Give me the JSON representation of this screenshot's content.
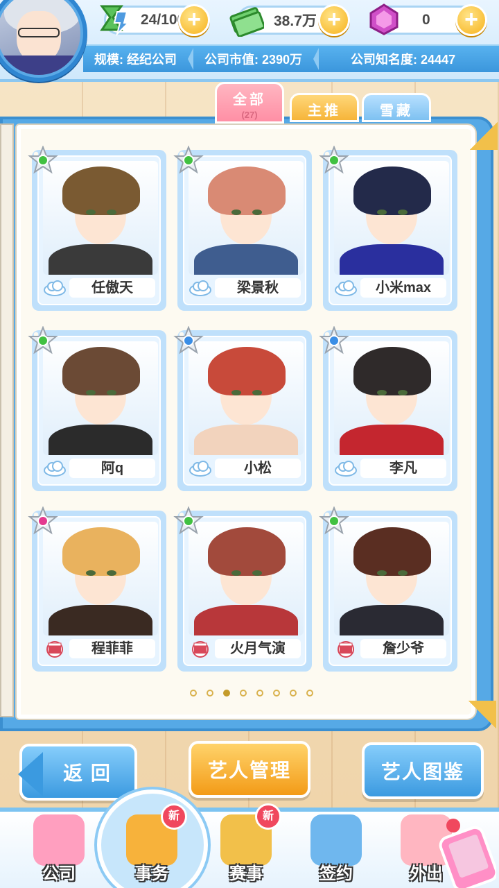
{
  "header": {
    "energy": "24/100",
    "money": "38.7万",
    "gems": "0",
    "stats": {
      "scale": "规模: 经纪公司",
      "market_value": "公司市值: 2390万",
      "fame": "公司知名度: 24447"
    }
  },
  "tabs": [
    {
      "label": "全部",
      "count": "(27)",
      "active": true
    },
    {
      "label": "主推"
    },
    {
      "label": "雪藏"
    }
  ],
  "artists": [
    {
      "name": "任傲天",
      "gem": "green",
      "type": "cloud-icon",
      "hair": "#7a5a32",
      "outfit": "#3a3a3a"
    },
    {
      "name": "梁景秋",
      "gem": "green",
      "type": "cloud-icon",
      "hair": "#d98a74",
      "outfit": "#3f5d8f"
    },
    {
      "name": "小米max",
      "gem": "green",
      "type": "cloud-icon",
      "hair": "#232a4a",
      "outfit": "#2a2f9e"
    },
    {
      "name": "阿q",
      "gem": "green",
      "type": "cloud-icon",
      "hair": "#6b4a35",
      "outfit": "#2b2b2b"
    },
    {
      "name": "小松",
      "gem": "blue",
      "type": "cloud-icon",
      "hair": "#c84a3a",
      "outfit": "#f2d3bd"
    },
    {
      "name": "李凡",
      "gem": "blue",
      "type": "cloud-icon",
      "hair": "#2f2a2a",
      "outfit": "#c4262f"
    },
    {
      "name": "程菲菲",
      "gem": "pink",
      "type": "film-icon",
      "hair": "#e9b25e",
      "outfit": "#3a2a22"
    },
    {
      "name": "火月气演",
      "gem": "green",
      "type": "film-icon",
      "hair": "#a24a3c",
      "outfit": "#b8373a"
    },
    {
      "name": "詹少爷",
      "gem": "green",
      "type": "film-icon",
      "hair": "#5a2e22",
      "outfit": "#2a2a33"
    }
  ],
  "pagination": {
    "total": 8,
    "current": 3
  },
  "buttons": {
    "back": "返 回",
    "manage": "艺人管理",
    "gallery": "艺人图鉴"
  },
  "nav": [
    {
      "label": "公司",
      "icon": "store-icon"
    },
    {
      "label": "事务",
      "icon": "manager-icon",
      "badge": "新",
      "active": true
    },
    {
      "label": "赛事",
      "icon": "trophy-icon",
      "badge": "新"
    },
    {
      "label": "签约",
      "icon": "contract-icon"
    },
    {
      "label": "外出",
      "icon": "door-icon"
    }
  ],
  "colors": {
    "primary": "#3b9ae0",
    "accent": "#f39b17",
    "tab_all": "#ff8fa5",
    "badge": "#f0485e"
  }
}
